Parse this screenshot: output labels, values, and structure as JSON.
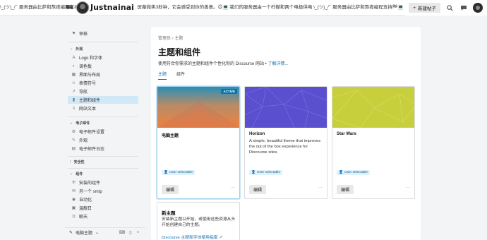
{
  "header": {
    "marquee": "\\_(ツ)_/¯ 服务器由比萨和熬夜编程支持🏁💻  如果网页打不开，请对屏幕微笑3秒钟，它会感受到你的善意。😊💻  我们的服务器由一个柠檬和两个电极供电 \\_(ツ)_/¯ 服务器由比萨和熬夜编程支持🏁💻",
    "brand": "Justnainai",
    "new_topic": "新建帖子",
    "new_topic_icon": "plus-icon",
    "search_icon": "search-icon",
    "chat_icon": "chat-bubble-icon"
  },
  "sidebar": {
    "top_item": {
      "label": "审核",
      "icon": "flag-icon"
    },
    "sections": [
      {
        "title": "外观",
        "items": [
          {
            "label": "Logo 和字体",
            "icon": "font-icon"
          },
          {
            "label": "调色板",
            "icon": "palette-icon"
          },
          {
            "label": "界面与布局",
            "icon": "layout-icon"
          },
          {
            "label": "表情符号",
            "icon": "smile-icon"
          },
          {
            "label": "导航",
            "icon": "nav-icon"
          },
          {
            "label": "主题和组件",
            "icon": "paint-icon",
            "active": true
          },
          {
            "label": "网站文本",
            "icon": "text-icon"
          }
        ]
      },
      {
        "title": "电子邮件",
        "items": [
          {
            "label": "电子邮件设置",
            "icon": "gear-icon"
          },
          {
            "label": "外观",
            "icon": "brush-icon"
          },
          {
            "label": "电子邮件日志",
            "icon": "log-icon"
          }
        ]
      },
      {
        "title": "安全性",
        "items": []
      },
      {
        "title": "组件",
        "items": [
          {
            "label": "安装的组件",
            "icon": "puzzle-icon"
          },
          {
            "label": "另一个 smtp",
            "icon": "mail-icon"
          },
          {
            "label": "自动化",
            "icon": "robot-icon"
          },
          {
            "label": "温靓日",
            "icon": "calendar-icon"
          },
          {
            "label": "聊天",
            "icon": "chat-icon"
          }
        ]
      }
    ],
    "footer": {
      "label": "电脑主题"
    }
  },
  "main": {
    "breadcrumb": "管理员 › 主题",
    "title": "主题和组件",
    "description": "使用符合你需求的主题和组件个性化你的 Discourse 网站 •",
    "learn_more": "了解详情...",
    "tabs": [
      "主题",
      "组件"
    ],
    "cards": [
      {
        "name": "电脑主题",
        "description": "",
        "badge": "ACTIVE",
        "pill": "User selectable",
        "edit": "编辑",
        "more": "···"
      },
      {
        "name": "Horizon",
        "description": "A simple, beautiful theme that improves the out of the box experience for Discourse sites.",
        "pill": "User selectable",
        "edit": "编辑",
        "more": "···"
      },
      {
        "name": "Star Wars",
        "description": "",
        "pill": "User selectable",
        "edit": "编辑",
        "more": "···"
      }
    ],
    "new_theme": {
      "title": "新主题",
      "description": "安装新主题以开始，或使用这些资源从头开始创建自己的主题。",
      "link": "Discourse 主题和字体使用指南"
    }
  }
}
